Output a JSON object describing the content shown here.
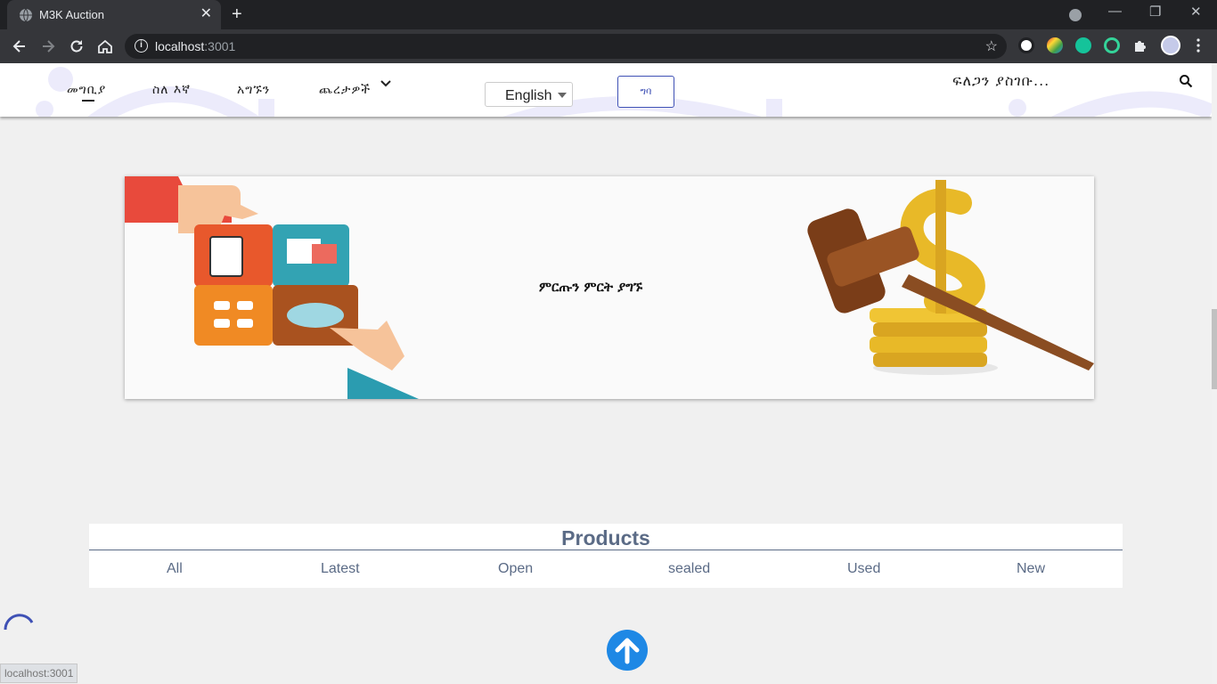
{
  "browser": {
    "tab_title": "M3K Auction",
    "tab_close": "✕",
    "new_tab": "+",
    "url_host": "localhost",
    "url_port": ":3001",
    "info_icon": "i",
    "star": "☆",
    "win_minimize": "—",
    "win_restore": "❐",
    "win_close": "✕"
  },
  "navbar": {
    "links": [
      "መግቢያ",
      "ስለ እኛ",
      "አግኙን",
      "ጨረታዎች"
    ],
    "language": "English",
    "login_label": "ግባ",
    "search_placeholder": "ፍለጋን ያስገቡ..."
  },
  "banner": {
    "text": "ምርጡን ምርት ያግኙ"
  },
  "products": {
    "title": "Products",
    "tabs": [
      "All",
      "Latest",
      "Open",
      "sealed",
      "Used",
      "New"
    ]
  },
  "status_bar": {
    "url": "localhost:3001"
  },
  "colors": {
    "accent": "#3f51b5",
    "products_text": "#5b6b86",
    "up_button": "#1e88e5"
  }
}
